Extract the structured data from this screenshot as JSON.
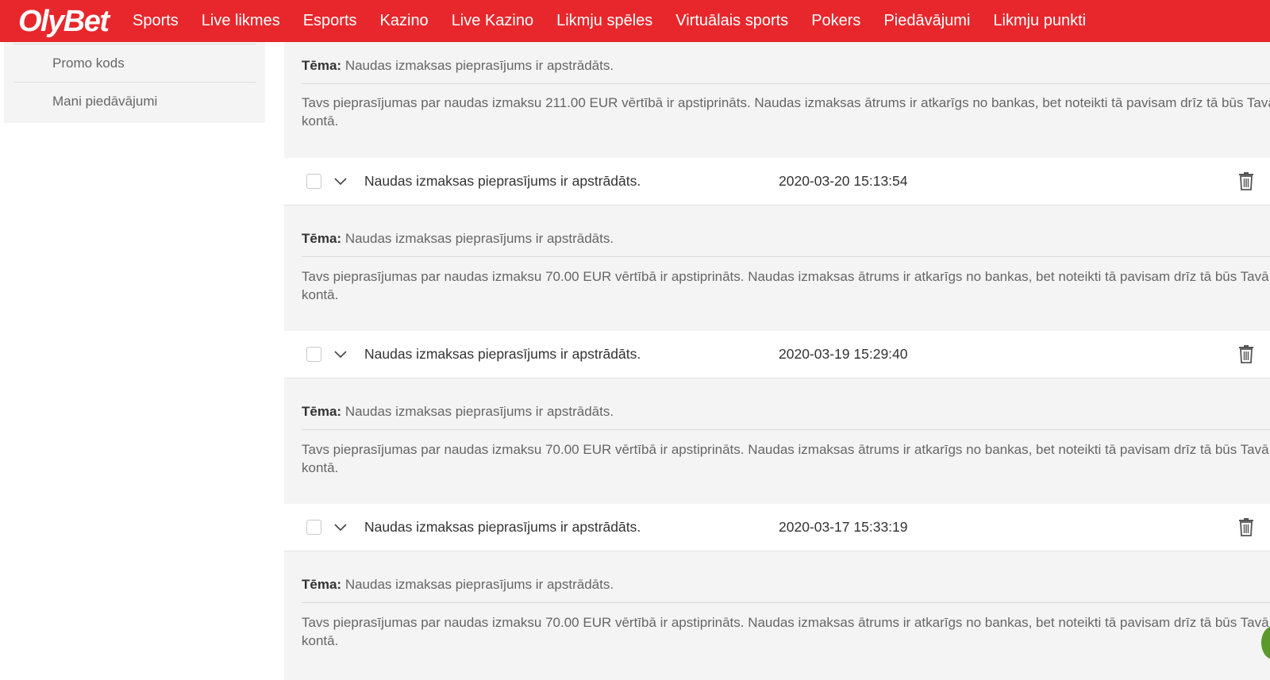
{
  "brand": {
    "logo": "OlyBet",
    "accent_color": "#e8272c"
  },
  "nav": [
    "Sports",
    "Live likmes",
    "Esports",
    "Kazino",
    "Live Kazino",
    "Likmju spēles",
    "Virtuālais sports",
    "Pokers",
    "Piedāvājumi",
    "Likmju punkti"
  ],
  "sidebar": {
    "items": [
      "Promo kods",
      "Mani piedāvājumi"
    ]
  },
  "subject_label": "Tēma:",
  "messages": [
    {
      "subject": "Naudas izmaksas pieprasījums ir apstrādāts.",
      "body": "Tavs pieprasījumas par naudas izmaksu 211.00 EUR vērtībā ir apstiprināts. Naudas izmaksas ātrums ir atkarīgs no bankas, bet noteikti tā pavisam drīz tā būs Tavā kontā."
    },
    {
      "title": "Naudas izmaksas pieprasījums ir apstrādāts.",
      "date": "2020-03-20 15:13:54",
      "subject": "Naudas izmaksas pieprasījums ir apstrādāts.",
      "body": "Tavs pieprasījumas par naudas izmaksu 70.00 EUR vērtībā ir apstiprināts. Naudas izmaksas ātrums ir atkarīgs no bankas, bet noteikti tā pavisam drīz tā būs Tavā kontā."
    },
    {
      "title": "Naudas izmaksas pieprasījums ir apstrādāts.",
      "date": "2020-03-19 15:29:40",
      "subject": "Naudas izmaksas pieprasījums ir apstrādāts.",
      "body": "Tavs pieprasījumas par naudas izmaksu 70.00 EUR vērtībā ir apstiprināts. Naudas izmaksas ātrums ir atkarīgs no bankas, bet noteikti tā pavisam drīz tā būs Tavā kontā."
    },
    {
      "title": "Naudas izmaksas pieprasījums ir apstrādāts.",
      "date": "2020-03-17 15:33:19",
      "subject": "Naudas izmaksas pieprasījums ir apstrādāts.",
      "body": "Tavs pieprasījumas par naudas izmaksu 70.00 EUR vērtībā ir apstiprināts. Naudas izmaksas ātrums ir atkarīgs no bankas, bet noteikti tā pavisam drīz tā būs Tavā kontā."
    }
  ]
}
